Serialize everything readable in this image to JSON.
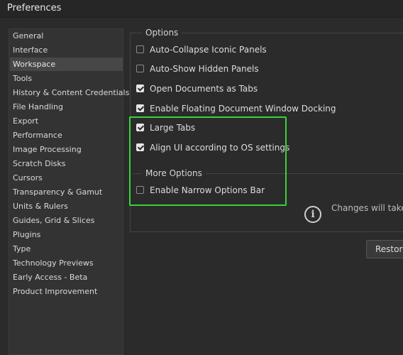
{
  "window": {
    "title": "Preferences"
  },
  "sidebar": {
    "items": [
      {
        "label": "General"
      },
      {
        "label": "Interface"
      },
      {
        "label": "Workspace",
        "selected": true
      },
      {
        "label": "Tools"
      },
      {
        "label": "History & Content Credentials"
      },
      {
        "label": "File Handling"
      },
      {
        "label": "Export"
      },
      {
        "label": "Performance"
      },
      {
        "label": "Image Processing"
      },
      {
        "label": "Scratch Disks"
      },
      {
        "label": "Cursors"
      },
      {
        "label": "Transparency & Gamut"
      },
      {
        "label": "Units & Rulers"
      },
      {
        "label": "Guides, Grid & Slices"
      },
      {
        "label": "Plugins"
      },
      {
        "label": "Type"
      },
      {
        "label": "Technology Previews"
      },
      {
        "label": "Early Access - Beta"
      },
      {
        "label": "Product Improvement"
      }
    ]
  },
  "options": {
    "title": "Options",
    "checkboxes": [
      {
        "label": "Auto-Collapse Iconic Panels",
        "checked": false
      },
      {
        "label": "Auto-Show Hidden Panels",
        "checked": false
      },
      {
        "label": "Open Documents as Tabs",
        "checked": true
      },
      {
        "label": "Enable Floating Document Window Docking",
        "checked": true
      },
      {
        "label": "Large Tabs",
        "checked": true
      },
      {
        "label": "Align UI according to OS settings",
        "checked": true
      }
    ]
  },
  "more_options": {
    "title": "More Options",
    "checkboxes": [
      {
        "label": "Enable Narrow Options Bar",
        "checked": false
      }
    ]
  },
  "info": {
    "icon": "info-icon",
    "text": "Changes will take"
  },
  "buttons": {
    "restore": "Restore"
  },
  "colors": {
    "highlight": "#39d33b",
    "selected_bg": "#474747"
  }
}
